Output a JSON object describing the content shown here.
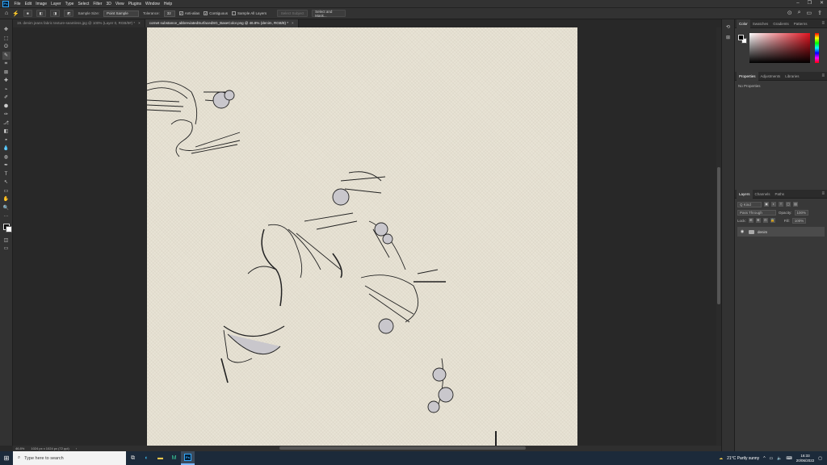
{
  "app": {
    "logo": "Ps"
  },
  "menu": [
    "File",
    "Edit",
    "Image",
    "Layer",
    "Type",
    "Select",
    "Filter",
    "3D",
    "View",
    "Plugins",
    "Window",
    "Help"
  ],
  "window_controls": [
    "–",
    "❐",
    "✕"
  ],
  "options": {
    "sample_size_label": "Sample Size:",
    "sample_size_value": "Point Sample",
    "tolerance_label": "Tolerance:",
    "tolerance_value": "32",
    "anti_alias": "Anti-alias",
    "contiguous": "Contiguous",
    "sample_all_layers": "Sample All Layers",
    "select_subject": "Select Subject",
    "select_and_mask": "Select and Mask..."
  },
  "tabs": [
    {
      "label": "19. denim jeans fabric texture-seamless.jpg @ 100% (Layer 0, RGB/8#) *",
      "close": "×"
    },
    {
      "label": "cornet substance_abbreviatedSurfacedSG_BaseColor.png @ 46.8% (denim, RGB/8) *",
      "close": "×"
    }
  ],
  "tools": [
    "✥",
    "⬚",
    "ʘ",
    "✎",
    "⌗",
    "⊠",
    "✚",
    "⌁",
    "✐",
    "⬢",
    "✑",
    "⎇",
    "◧",
    "◓",
    "💧",
    "◍",
    "✒",
    "T",
    "↖",
    "▭",
    "✋",
    "🔍",
    "···"
  ],
  "status": {
    "zoom": "46.8%",
    "doc_size": "1024 px x 1024 px (72 ppi)",
    "arrow": "›"
  },
  "panels": {
    "color_tabs": [
      "Color",
      "Swatches",
      "Gradients",
      "Patterns"
    ],
    "props_tabs": [
      "Properties",
      "Adjustments",
      "Libraries"
    ],
    "props_text": "No Properties",
    "layers_tabs": [
      "Layers",
      "Channels",
      "Paths"
    ],
    "kind_label": "Q Kind",
    "blend_mode": "Pass Through",
    "opacity_label": "Opacity:",
    "opacity_value": "100%",
    "lock_label": "Lock:",
    "fill_label": "Fill:",
    "fill_value": "100%",
    "layer_name": "denim",
    "menu_glyph": "≡"
  },
  "right_icons": [
    "⟲",
    "⊞",
    "≋",
    "◐"
  ],
  "taskbar": {
    "search_placeholder": "Type here to search",
    "weather": "21°C  Partly sunny",
    "time": "16:33",
    "date": "20/06/2022"
  }
}
